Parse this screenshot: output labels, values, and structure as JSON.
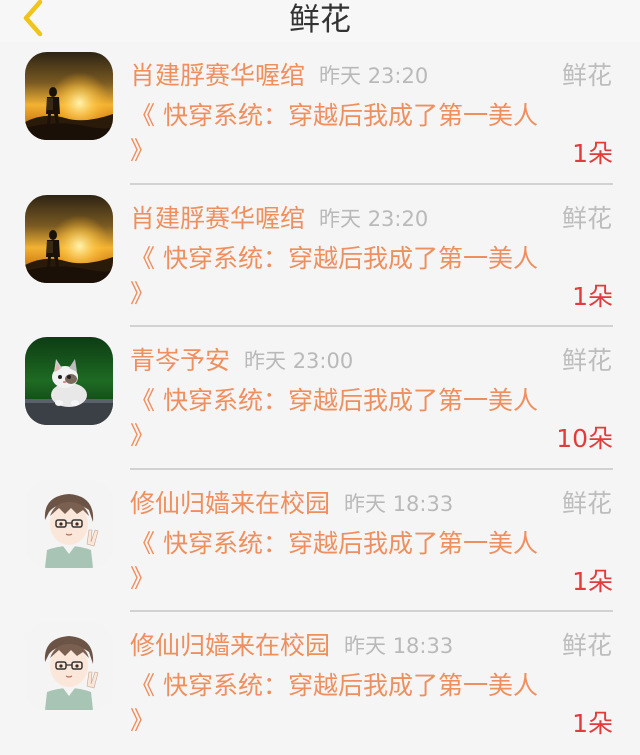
{
  "header": {
    "title": "鲜花",
    "back_icon": "chevron-left-icon",
    "back_color": "#f0c419"
  },
  "records": [
    {
      "avatar": "sunset-hiker-avatar",
      "sender": "肖建脬赛华喔绾",
      "time": "昨天 23:20",
      "type": "鲜花",
      "book": "《 快穿系统：穿越后我成了第一美人 》",
      "count": "1朵"
    },
    {
      "avatar": "sunset-hiker-avatar",
      "sender": "肖建脬赛华喔绾",
      "time": "昨天 23:20",
      "type": "鲜花",
      "book": "《 快穿系统：穿越后我成了第一美人 》",
      "count": "1朵"
    },
    {
      "avatar": "kitten-avatar",
      "sender": "青岑予安",
      "time": "昨天 23:00",
      "type": "鲜花",
      "book": "《 快穿系统：穿越后我成了第一美人 》",
      "count": "10朵"
    },
    {
      "avatar": "anime-boy-avatar",
      "sender": "修仙归嫱来在校园",
      "time": "昨天 18:33",
      "type": "鲜花",
      "book": "《 快穿系统：穿越后我成了第一美人 》",
      "count": "1朵"
    },
    {
      "avatar": "anime-boy-avatar",
      "sender": "修仙归嫱来在校园",
      "time": "昨天 18:33",
      "type": "鲜花",
      "book": "《 快穿系统：穿越后我成了第一美人 》",
      "count": "1朵"
    }
  ],
  "colors": {
    "sender": "#ef8f5e",
    "time": "#b9b9b9",
    "type": "#bdbdbd",
    "count": "#e23b3b"
  }
}
